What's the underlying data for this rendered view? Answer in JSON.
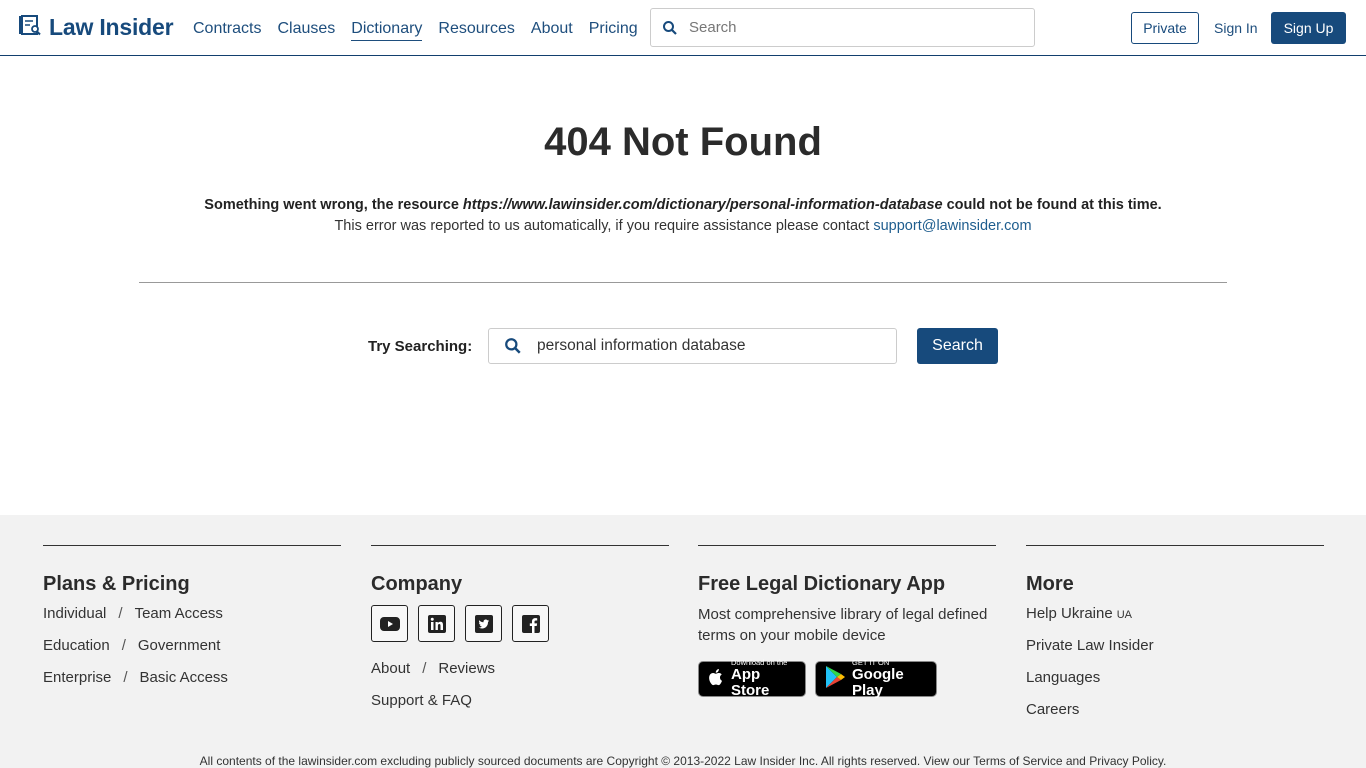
{
  "header": {
    "logo_text": "Law Insider",
    "nav": [
      "Contracts",
      "Clauses",
      "Dictionary",
      "Resources",
      "About",
      "Pricing"
    ],
    "active_nav": "Dictionary",
    "search_placeholder": "Search",
    "private_label": "Private",
    "signin_label": "Sign In",
    "signup_label": "Sign Up"
  },
  "main": {
    "title": "404 Not Found",
    "msg_prefix": "Something went wrong, the resource ",
    "msg_url": "https://www.lawinsider.com/dictionary/personal-information-database",
    "msg_suffix": " could not be found at this time.",
    "msg2_text": "This error was reported to us automatically, if you require assistance please contact ",
    "support_email": "support@lawinsider.com",
    "try_label": "Try Searching:",
    "try_value": "personal information database",
    "search_button": "Search"
  },
  "footer": {
    "plans": {
      "title": "Plans & Pricing",
      "rows": [
        [
          "Individual",
          "Team Access"
        ],
        [
          "Education",
          "Government"
        ],
        [
          "Enterprise",
          "Basic Access"
        ]
      ]
    },
    "company": {
      "title": "Company",
      "socials": [
        "youtube-icon",
        "linkedin-icon",
        "twitter-icon",
        "facebook-icon"
      ],
      "rows": [
        [
          "About",
          "Reviews"
        ],
        [
          "Support & FAQ"
        ]
      ]
    },
    "app": {
      "title": "Free Legal Dictionary App",
      "desc": "Most comprehensive library of legal defined terms on your mobile device",
      "appstore_small": "Download on the",
      "appstore_big": "App Store",
      "googleplay_small": "GET IT ON",
      "googleplay_big": "Google Play"
    },
    "more": {
      "title": "More",
      "help_ukraine": "Help Ukraine",
      "ua": "UA",
      "items": [
        "Private Law Insider",
        "Languages",
        "Careers"
      ]
    },
    "copyright": "All contents of the lawinsider.com excluding publicly sourced documents are Copyright © 2013-2022 Law Insider Inc. All rights reserved. View our Terms of Service and Privacy Policy."
  }
}
